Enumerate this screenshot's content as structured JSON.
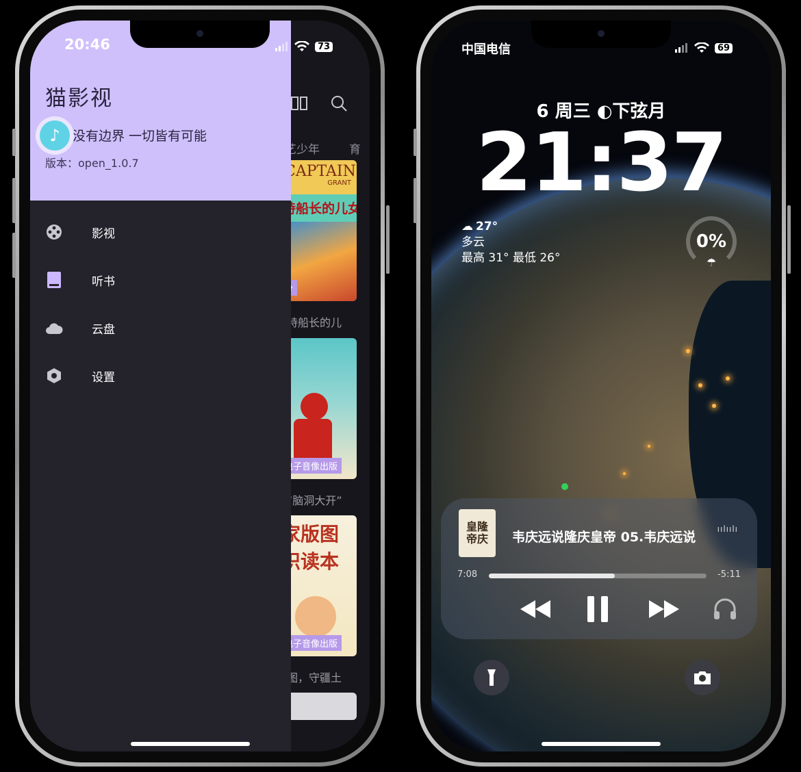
{
  "left_phone": {
    "status_time": "20:46",
    "battery": "73",
    "behind": {
      "tabs": [
        "艺少年",
        "育"
      ],
      "captions": [
        "特船长的儿",
        "“脑洞大开”",
        "图，守疆土"
      ],
      "badges": [
        "分",
        "电子音像出版",
        "电子音像出版"
      ],
      "cover1_text": "CAPTAIN",
      "cover1_sub": "GRANT",
      "cover1_cn": "特船长的儿女",
      "cover3_cn": "家版图",
      "cover3_cn2": "识读本"
    },
    "drawer": {
      "title": "猫影视",
      "slogan": "没有边界 一切皆有可能",
      "version": "版本：open_1.0.7",
      "menu": [
        {
          "label": "影视",
          "icon": "film-reel-icon"
        },
        {
          "label": "听书",
          "icon": "book-icon"
        },
        {
          "label": "云盘",
          "icon": "cloud-icon"
        },
        {
          "label": "设置",
          "icon": "gear-hex-icon"
        }
      ]
    },
    "accent": "#cfc0fb"
  },
  "right_phone": {
    "carrier": "中国电信",
    "battery": "69",
    "date": "6 周三 ◐下弦月",
    "time": "21:37",
    "weather": {
      "temp": "27°",
      "condition": "多云",
      "range": "最高 31° 最低 26°"
    },
    "rain_chance": "0%",
    "player": {
      "album_text": "皇隆帝庆",
      "track": "韦庆远说隆庆皇帝 05.韦庆远说",
      "elapsed": "7:08",
      "remaining": "-5:11",
      "progress": 0.58
    }
  }
}
